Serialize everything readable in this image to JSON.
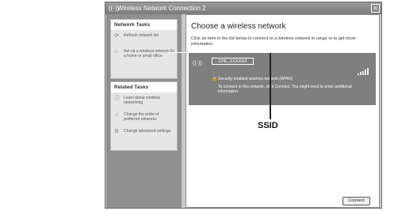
{
  "window": {
    "title": "Wireless Network Connection 2",
    "close_symbol": "✕"
  },
  "sidebar": {
    "network_tasks": {
      "title": "Network Tasks",
      "items": [
        {
          "label": "Refresh network list",
          "icon": "refresh-icon"
        },
        {
          "label": "Set up a wireless network for a home or small office",
          "icon": "setup-icon"
        }
      ]
    },
    "related_tasks": {
      "title": "Related Tasks",
      "items": [
        {
          "label": "Learn about wireless networking",
          "icon": "info-icon"
        },
        {
          "label": "Change the order of preferred networks",
          "icon": "star-icon"
        },
        {
          "label": "Change advanced settings",
          "icon": "settings-icon"
        }
      ]
    }
  },
  "main": {
    "heading": "Choose a wireless network",
    "instructions": "Click an item in the list below to connect to a wireless network in range or to get more information.",
    "network": {
      "ssid": "CPE_XXXXXX",
      "security": "Security-enabled wireless network (WPA2)",
      "connect_hint": "To connect to this network, click Connect. You might need to enter additional information.",
      "signal_bars": 5
    },
    "connect_label": "Connect"
  },
  "annotation": {
    "label": "SSID"
  }
}
